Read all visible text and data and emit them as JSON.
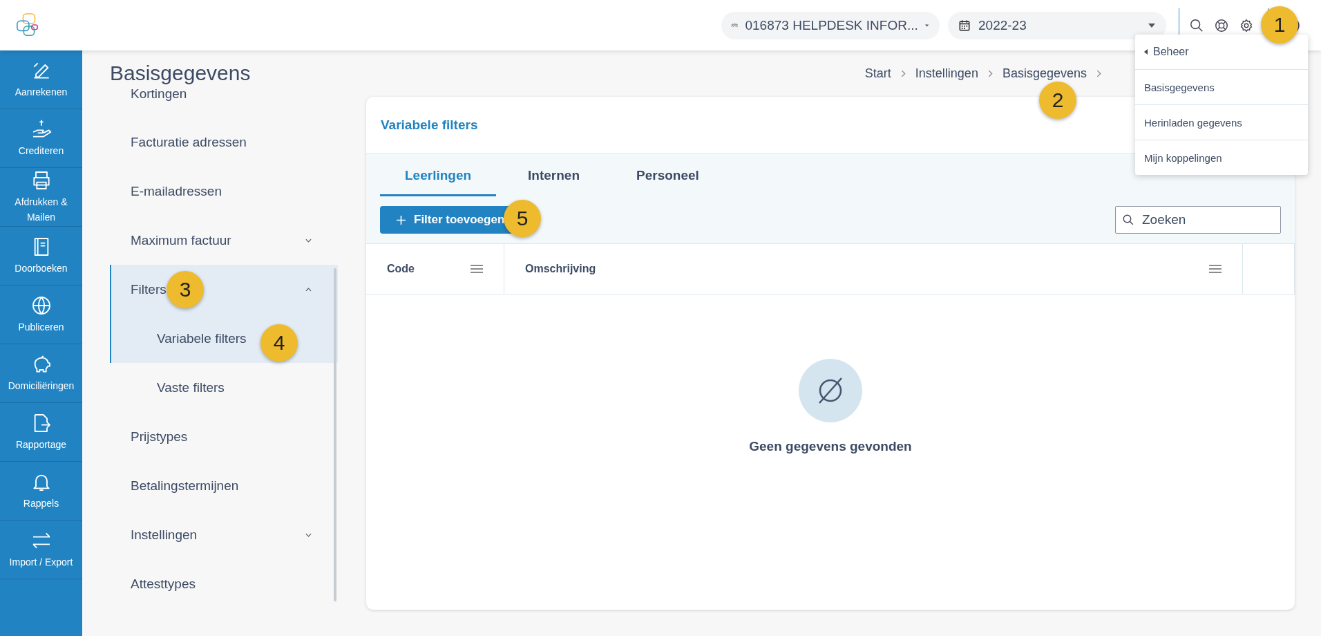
{
  "topbar": {
    "organisation": "016873 HELPDESK INFOR...",
    "school_year": "2022-23"
  },
  "user_menu": {
    "back": "Beheer",
    "items": [
      "Basisgegevens",
      "Herinladen gegevens",
      "Mijn koppelingen"
    ]
  },
  "nav": [
    {
      "label": "Aanrekenen"
    },
    {
      "label": "Crediteren"
    },
    {
      "label": "Afdrukken & Mailen"
    },
    {
      "label": "Doorboeken"
    },
    {
      "label": "Publiceren"
    },
    {
      "label": "Domiciliëringen"
    },
    {
      "label": "Rapportage"
    },
    {
      "label": "Rappels"
    },
    {
      "label": "Import / Export"
    }
  ],
  "page_title": "Basisgegevens",
  "breadcrumb": [
    "Start",
    "Instellingen",
    "Basisgegevens"
  ],
  "submenu": [
    {
      "label": "Kortingen"
    },
    {
      "label": "Facturatie adressen"
    },
    {
      "label": "E-mailadressen"
    },
    {
      "label": "Maximum factuur",
      "expanded": false
    },
    {
      "label": "Filters",
      "expanded": true,
      "children": [
        {
          "label": "Variabele filters",
          "selected": true
        },
        {
          "label": "Vaste filters",
          "selected": false
        }
      ]
    },
    {
      "label": "Prijstypes"
    },
    {
      "label": "Betalingstermijnen"
    },
    {
      "label": "Instellingen",
      "expanded": false
    },
    {
      "label": "Attesttypes"
    }
  ],
  "card": {
    "title": "Variabele filters",
    "tabs": [
      {
        "label": "Leerlingen",
        "selected": true
      },
      {
        "label": "Internen",
        "selected": false
      },
      {
        "label": "Personeel",
        "selected": false
      }
    ],
    "add_button": "Filter toevoegen",
    "search": {
      "placeholder": "Zoeken"
    },
    "table": {
      "columns": [
        "Code",
        "Omschrijving"
      ]
    },
    "empty_message": "Geen gegevens gevonden"
  },
  "callouts": [
    "1",
    "2",
    "3",
    "4",
    "5"
  ]
}
